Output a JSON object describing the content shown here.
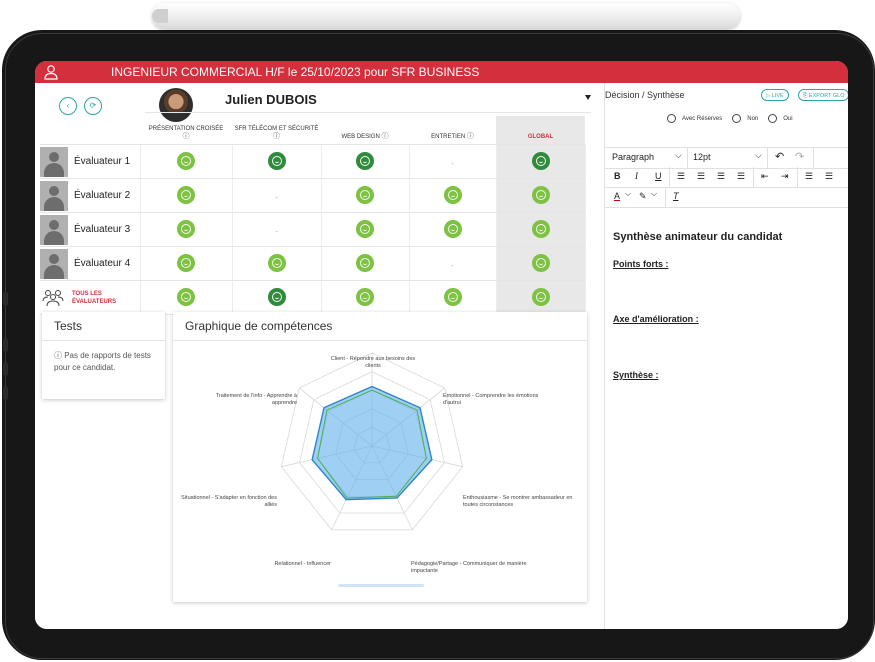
{
  "header": {
    "title": "INGENIEUR COMMERCIAL H/F le 25/10/2023 pour SFR BUSINESS"
  },
  "candidate": {
    "name": "Julien DUBOIS"
  },
  "grid": {
    "columns": [
      "PRÉSENTATION CROISÉE",
      "SFR TÉLÉCOM ET SÉCURITÉ",
      "WEB DESIGN",
      "ENTRETIEN",
      "GLOBAL"
    ],
    "info_glyph": "ⓘ",
    "dash": "-",
    "rows": [
      {
        "name": "Évaluateur 1",
        "cells": [
          "light",
          "dark",
          "dark",
          "none",
          "dark"
        ]
      },
      {
        "name": "Évaluateur 2",
        "cells": [
          "light",
          "none",
          "light",
          "light",
          "light"
        ]
      },
      {
        "name": "Évaluateur 3",
        "cells": [
          "light",
          "none",
          "light",
          "light",
          "light"
        ]
      },
      {
        "name": "Évaluateur 4",
        "cells": [
          "light",
          "light",
          "light",
          "none",
          "light"
        ]
      }
    ],
    "all": {
      "label_line1": "TOUS LES",
      "label_line2": "ÉVALUATEURS",
      "cells": [
        "light",
        "dark",
        "light",
        "light",
        "light"
      ]
    }
  },
  "tests": {
    "title": "Tests",
    "message": "ⓘ Pas de rapports de tests pour ce candidat."
  },
  "radar": {
    "title": "Graphique de compétences",
    "labels": [
      "Client - Répondre aux besoins des clients",
      "Emotionnel - Comprendre les émotions d'autrui",
      "Enthousiasme - Se montrer ambassadeur en toutes circonstances",
      "Pédagogie/Partage - Communiquer de manière impactante",
      "Relationnel - Influencer",
      "Situationnel - S'adapter en fonction des alliés",
      "Traitement de l'info - Apprendre à apprendre"
    ]
  },
  "chart_data": {
    "type": "radar",
    "axes": [
      "Client - Répondre aux besoins des clients",
      "Emotionnel - Comprendre les émotions d'autrui",
      "Enthousiasme - Se montrer ambassadeur en toutes circonstances",
      "Pédagogie/Partage - Communiquer de manière impactante",
      "Relationnel - Influencer",
      "Situationnel - S'adapter en fonction des alliés",
      "Traitement de l'info - Apprendre à apprendre"
    ],
    "range": [
      0,
      5
    ],
    "series": [
      {
        "values": [
          3.2,
          3.3,
          3.3,
          3.1,
          3.2,
          3.3,
          3.3
        ],
        "color": "#2e86c9"
      },
      {
        "values": [
          3.0,
          3.1,
          3.0,
          3.0,
          3.1,
          3.0,
          3.1
        ],
        "color": "#4caf50"
      }
    ]
  },
  "right": {
    "title": "Décision / Synthèse",
    "live_label": "▷ LIVE",
    "export_label": "⎘ EXPORT GLO",
    "radios": [
      "Avec Réserves",
      "Non",
      "Oui"
    ],
    "toolbar": {
      "paragraph": "Paragraph",
      "font_size": "12pt",
      "chevron": "⌵",
      "undo": "↶",
      "redo": "↷",
      "bold": "B",
      "italic": "I",
      "underline": "U",
      "align_left": "☰",
      "align_center": "☰",
      "align_right": "☰",
      "justify": "☰",
      "outdent": "⇤",
      "indent": "⇥",
      "bullets": "☰",
      "numbers": "☰",
      "font_color": "A",
      "highlight": "✎",
      "clear_format": "T"
    },
    "editor": {
      "title": "Synthèse animateur du candidat",
      "sections": [
        "Points forts :",
        "Axe d'amélioration :",
        "Synthèse :"
      ]
    }
  },
  "colors": {
    "brand": "#d32f3c",
    "accent": "#2aa7a7",
    "smile_light": "#7dc242",
    "smile_dark": "#2f8a3b"
  }
}
